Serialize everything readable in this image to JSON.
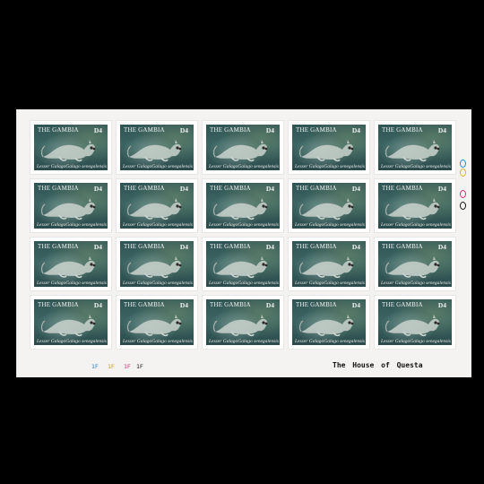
{
  "stamp": {
    "country": "THE GAMBIA",
    "value": "D4",
    "common_name": "Lesser Galago",
    "scientific_name": "Galago senegalensis"
  },
  "sheet": {
    "rows": 4,
    "columns": 5,
    "imprint": "The House of Questa",
    "plate_numbers": [
      "1F",
      "1F",
      "1F",
      "1F"
    ],
    "plate_colors": [
      "#2a7fd0",
      "#c8a020",
      "#d0307a",
      "#222222"
    ],
    "traffic_light_colors": [
      "#1e8bd6",
      "#d8b430",
      "#d0307a",
      "#111111"
    ]
  },
  "colors": {
    "background": "#000000",
    "paper": "#f4f3f1",
    "design": "#2f5455"
  }
}
